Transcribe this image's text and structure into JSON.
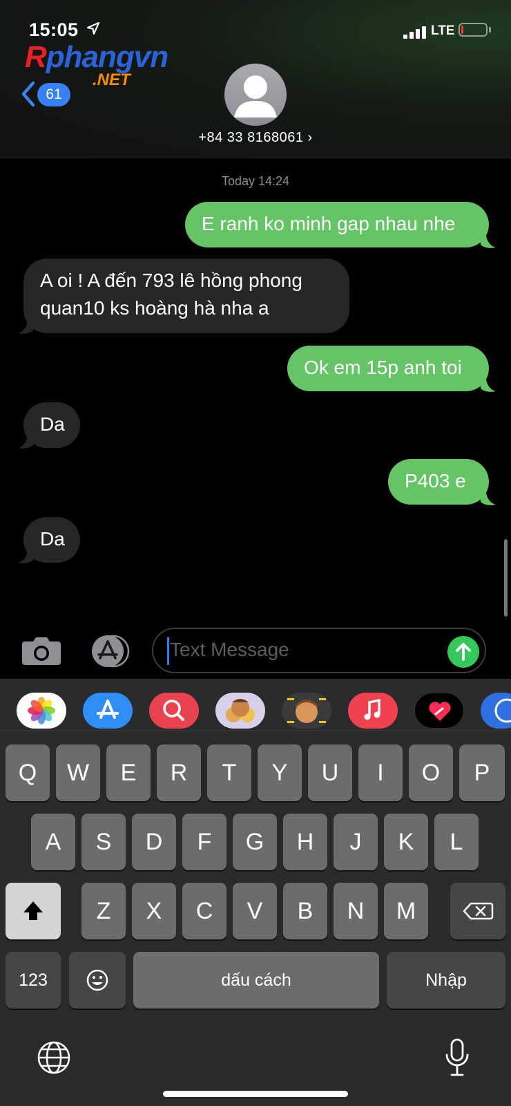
{
  "status_bar": {
    "time": "15:05",
    "network": "LTE",
    "signal_bars": 4,
    "battery_level": 0.08
  },
  "watermark": {
    "part_a": "R",
    "part_b": "phangvn",
    "suffix": ".NET"
  },
  "header": {
    "back_count": "61",
    "contact_name": "+84 33 8168061 ›"
  },
  "conversation": {
    "timestamp": "Today 14:24",
    "messages": [
      {
        "direction": "sent",
        "text": "E ranh ko minh gap nhau nhe"
      },
      {
        "direction": "received",
        "line1": "A oi ! A đến 793 lê hồng phong",
        "line2": "quan10 ks hoàng hà nha a"
      },
      {
        "direction": "sent",
        "text": "Ok em 15p anh toi"
      },
      {
        "direction": "received",
        "text": "Da"
      },
      {
        "direction": "sent",
        "text": "P403 e"
      },
      {
        "direction": "received",
        "text": "Da"
      }
    ]
  },
  "input": {
    "placeholder": "Text Message"
  },
  "app_strip": [
    "photos-app",
    "app-store-app",
    "image-search-app",
    "memoji-stickers-app",
    "memoji-app",
    "music-app",
    "digital-touch-app",
    "more-apps"
  ],
  "keyboard": {
    "row1": [
      "Q",
      "W",
      "E",
      "R",
      "T",
      "Y",
      "U",
      "I",
      "O",
      "P"
    ],
    "row2": [
      "A",
      "S",
      "D",
      "F",
      "G",
      "H",
      "J",
      "K",
      "L"
    ],
    "row3": [
      "Z",
      "X",
      "C",
      "V",
      "B",
      "N",
      "M"
    ],
    "numbers_label": "123",
    "space_label": "dấu cách",
    "return_label": "Nhập"
  },
  "colors": {
    "sent_bubble": "#65c466",
    "received_bubble": "#262628",
    "badge": "#3a80f5",
    "send_button": "#34c759"
  }
}
